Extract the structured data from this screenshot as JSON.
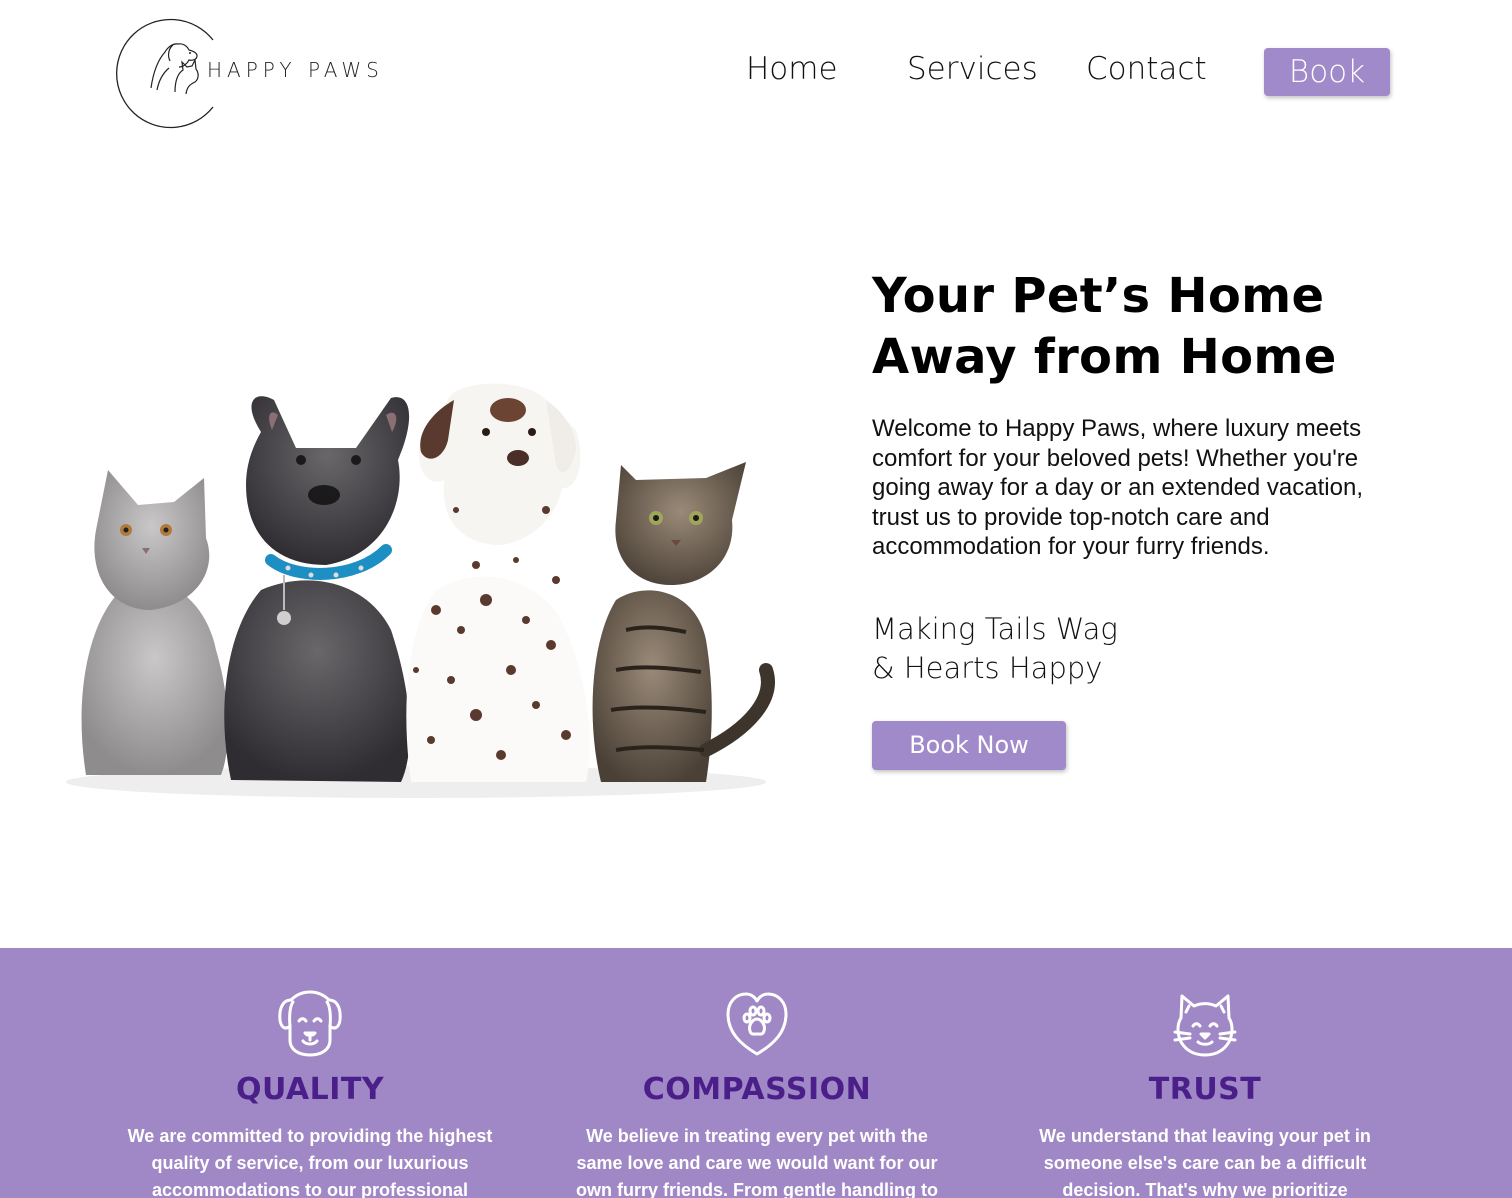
{
  "brand": {
    "name": "HAPPY PAWS"
  },
  "nav": {
    "items": [
      {
        "label": "Home"
      },
      {
        "label": "Services"
      },
      {
        "label": "Contact"
      }
    ],
    "book_label": "Book"
  },
  "hero": {
    "title": "Your Pet’s Home\nAway from Home",
    "intro": "Welcome to Happy Paws, where luxury meets comfort for your beloved pets! Whether you're going away for a day or an extended vacation, trust us to provide top-notch care and accommodation for your furry friends.",
    "tagline": "Making Tails Wag\n& Hearts Happy",
    "cta_label": "Book Now",
    "image_icon": "cats-and-dogs-photo"
  },
  "values": [
    {
      "icon": "dog-face-icon",
      "title": "QUALITY",
      "text": "We are committed to providing the highest quality of service, from our luxurious accommodations to our professional"
    },
    {
      "icon": "heart-paw-icon",
      "title": "COMPASSION",
      "text": "We believe in treating every pet with the same love and care we would want for our own furry friends. From gentle handling to"
    },
    {
      "icon": "cat-face-icon",
      "title": "TRUST",
      "text": "We understand that leaving your pet in someone else's care can be a difficult decision. That's why we prioritize"
    }
  ],
  "colors": {
    "accent": "#a08ac9",
    "band": "#a088c6",
    "value_title": "#4b1f8a"
  }
}
